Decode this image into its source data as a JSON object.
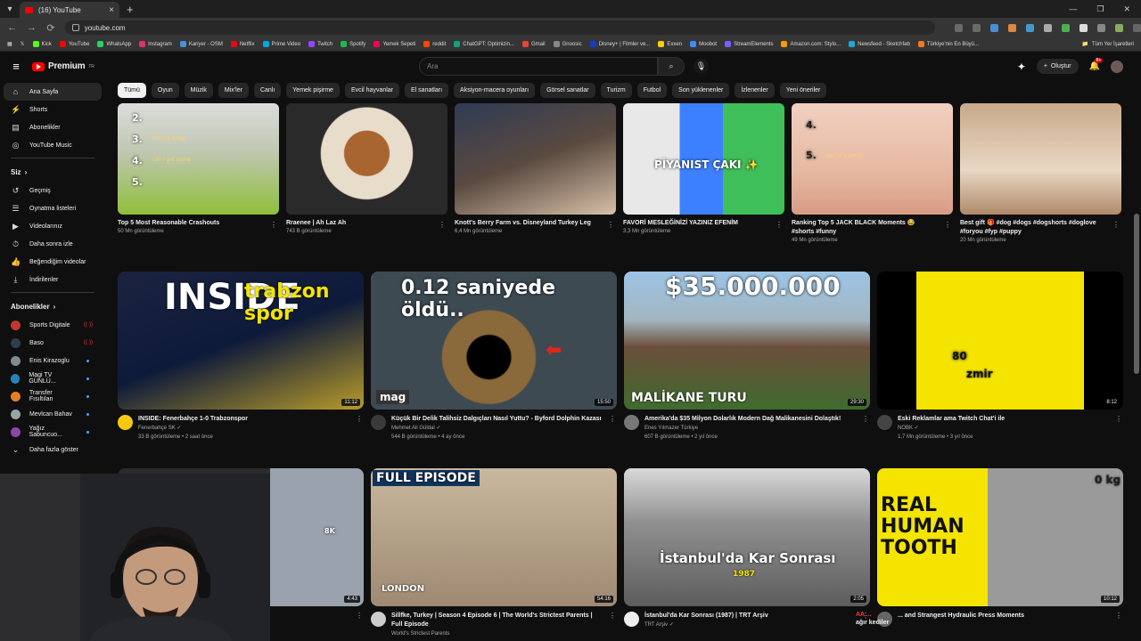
{
  "browser": {
    "tab_title": "(16) YouTube",
    "url": "youtube.com",
    "bookmarks": [
      "Kick",
      "YouTube",
      "WhatsApp",
      "Instagram",
      "Kariyer - OSM",
      "Netflix",
      "Prime Video",
      "Twitch",
      "Spotify",
      "Yemek Sepeti",
      "reddit",
      "ChatGPT: Optimizin...",
      "Gmail",
      "Gnoosic",
      "Disney+ | Filmler ve...",
      "Exxen",
      "Moobot",
      "StreamElements",
      "Amazon.com: Stylo...",
      "Newsfeed - Sketchfab",
      "Türkiye'nin En Büyü..."
    ],
    "bookmarks_all": "Tüm Yer İşaretleri",
    "bookmark_colors": [
      "#53fc18",
      "#ff0000",
      "#25d366",
      "#e1306c",
      "#4a90d9",
      "#e50914",
      "#00a8e1",
      "#9146ff",
      "#1db954",
      "#fa0050",
      "#ff4500",
      "#10a37f",
      "#ea4335",
      "#888888",
      "#113ccf",
      "#ffcc00",
      "#3d8bfd",
      "#7a5cff",
      "#ff9900",
      "#1caad9",
      "#f27a1a"
    ]
  },
  "masthead": {
    "logo_text": "Premium",
    "logo_sup": "TR",
    "search_placeholder": "Ara",
    "create_label": "Oluştur",
    "notif_count": "9+"
  },
  "chips": [
    "Tümü",
    "Oyun",
    "Müzik",
    "Mix'ler",
    "Canlı",
    "Yemek pişirme",
    "Evcil hayvanlar",
    "El sanatları",
    "Aksiyon-macera oyunları",
    "Görsel sanatlar",
    "Turizm",
    "Futbol",
    "Son yüklenenler",
    "İzlenenler",
    "Yeni öneriler"
  ],
  "sidebar": {
    "main": [
      "Ana Sayfa",
      "Shorts",
      "Abonelikler",
      "YouTube Music"
    ],
    "you_header": "Siz",
    "you": [
      "Geçmiş",
      "Oynatma listeleri",
      "Videolarınız",
      "Daha sonra izle",
      "Beğendiğim videolar",
      "İndirilenler"
    ],
    "subs_header": "Abonelikler",
    "subs": [
      {
        "name": "Sports Digitale",
        "color": "#c0392b",
        "live": "((·))"
      },
      {
        "name": "Baso",
        "color": "#2c3e50",
        "live": "((·))"
      },
      {
        "name": "Enis Kirazoglu",
        "color": "#7f8c8d",
        "live": ""
      },
      {
        "name": "Magi TV GÜNLÜ...",
        "color": "#2980b9",
        "live": ""
      },
      {
        "name": "Transfer Fısıltıları",
        "color": "#e67e22",
        "live": ""
      },
      {
        "name": "Mevlcan Bahav",
        "color": "#95a5a6",
        "live": ""
      },
      {
        "name": "Yağız Sabuncuo...",
        "color": "#8e44ad",
        "live": ""
      }
    ],
    "more": "Daha fazla göster"
  },
  "shorts": [
    {
      "title": "Top 5 Most Reasonable Crashouts",
      "meta": "50 Mn görüntüleme",
      "overlay": [
        "2.",
        "3.",
        "4.",
        "5."
      ],
      "overlay_notes": [
        "",
        "lettuce wrap",
        "can i get some",
        ""
      ]
    },
    {
      "title": "Rraenee | Ah Laz Ah",
      "meta": "743 B görüntüleme"
    },
    {
      "title": "Knott's Berry Farm vs. Disneyland Turkey Leg",
      "meta": "6,4 Mn görüntüleme"
    },
    {
      "title": "FAVORİ MESLEĞİNİZİ YAZINIZ EFENİM",
      "meta": "3,3 Mn görüntüleme",
      "overlay": [
        "PİYANIST ÇAKI ✨"
      ]
    },
    {
      "title": "Ranking Top 5 JACK BLACK Moments 😂 #shorts #funny",
      "meta": "49 Mn görüntüleme",
      "overlay": [
        "4.",
        "5."
      ],
      "overlay_notes": [
        "",
        "son of a b*tch"
      ]
    },
    {
      "title": "Best gift 🎁 #dog #dogs #dogshorts #doglove #foryou #fyp #puppy",
      "meta": "20 Mn görüntüleme"
    }
  ],
  "videos": [
    {
      "title": "INSIDE: Fenerbahçe 1-0 Trabzonspor",
      "channel": "Fenerbahçe SK ✓",
      "meta": "33 B görüntüleme • 2 saat önce",
      "duration": "11:12",
      "thumb_text": "INSIDE",
      "thumb_text2": "trabzon spor"
    },
    {
      "title": "Küçük Bir Delik Talihsiz Dalgıçları Nasıl Yuttu? - Byford Dolphin Kazası",
      "channel": "Mehmet Ali Güldal ✓",
      "meta": "544 B görüntüleme • 4 ay önce",
      "duration": "15:50",
      "thumb_text": "0.12 saniyede öldü..",
      "thumb_tag": "mag"
    },
    {
      "title": "Amerika'da $35 Milyon Dolarlık Modern Dağ Malikanesini Dolaştık!",
      "channel": "Enes Yılmazer Türkiye",
      "meta": "607 B görüntüleme • 2 yıl önce",
      "duration": "29:30",
      "thumb_text": "$35.000.000",
      "thumb_text2": "MALİKANE TURU"
    },
    {
      "title": "Eski Reklamlar ama Twitch Chat'i ile",
      "channel": "NOBK ✓",
      "meta": "1,7 Mn görüntüleme • 3 yıl önce",
      "duration": "8:12",
      "thumb_text": "80",
      "thumb_text2": "zmir"
    },
    {
      "title": "",
      "channel": "",
      "meta": "",
      "duration": "4:43",
      "thumb_text": "8K"
    },
    {
      "title": "Sillfke, Turkey | Season 4 Episode 6 | The World's Strictest Parents | Full Episode",
      "channel": "World's Strictest Parents",
      "meta": "",
      "duration": "54:16",
      "thumb_text": "FULL EPISODE",
      "thumb_text2": "LONDON"
    },
    {
      "title": "İstanbul'da Kar Sonrası (1987) | TRT Arşiv",
      "channel": "TRT Arşiv ✓",
      "meta": "",
      "duration": "2:05",
      "thumb_text": "İstanbul'da Kar Sonrası",
      "thumb_text2": "1987"
    },
    {
      "title": "... and Strangest Hydraulic Press Moments",
      "channel": "",
      "meta": "",
      "duration": "10:12",
      "thumb_text": "REAL HUMAN TOOTH",
      "thumb_text2": "0 kg"
    }
  ],
  "overlay": {
    "line1": "AA ...",
    "line2": "ağır kediler"
  }
}
